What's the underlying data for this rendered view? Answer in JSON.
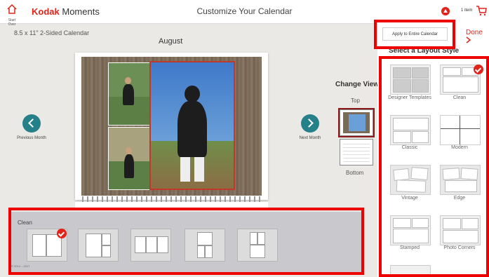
{
  "header": {
    "home_label": "Start Over",
    "brand_kodak": "Kodak",
    "brand_moments": "Moments",
    "title": "Customize Your Calendar",
    "cart_count": "1 item"
  },
  "editor": {
    "size_label": "8.5 x 11\" 2-Sided Calendar",
    "month": "August",
    "prev_label": "Previous Month",
    "next_label": "Next Month",
    "change_view": "Change View",
    "top_label": "Top",
    "bottom_label": "Bottom"
  },
  "sidebar": {
    "apply_label": "Apply to Entire Calendar",
    "done_label": "Done",
    "select_label": "Select a Layout Style",
    "styles": [
      "Designer Templates",
      "Clean",
      "Classic",
      "Modern",
      "Vintage",
      "Edge",
      "Stamped",
      "Photo Corners"
    ]
  },
  "layouts_panel": {
    "title": "Clean",
    "footnote": "© 2014 – 2017"
  },
  "colors": {
    "accent": "#e2231a",
    "nav": "#26808a"
  }
}
